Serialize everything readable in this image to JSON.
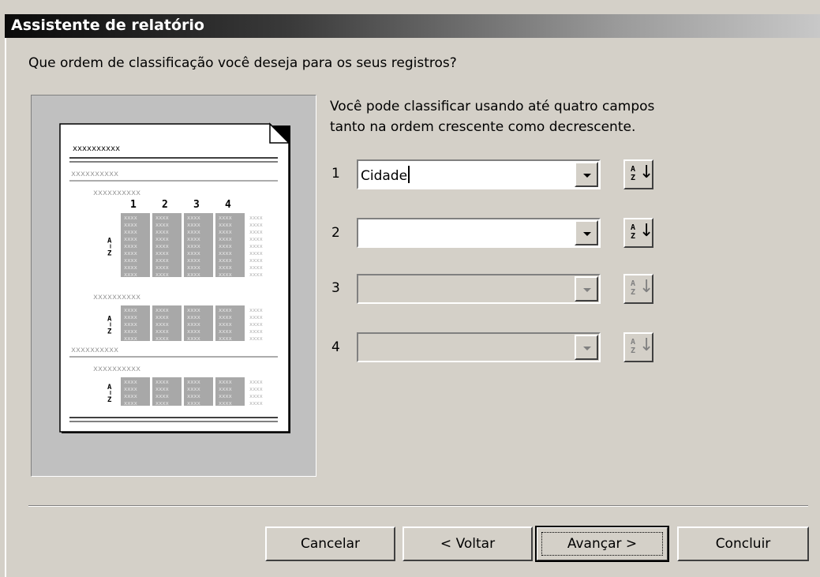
{
  "window": {
    "title": "Assistente de relatório"
  },
  "prompt": {
    "question": "Que ordem de classificação você deseja para os seus registros?"
  },
  "intro": {
    "line1": "Você pode classificar usando até quatro campos",
    "line2": "tanto na ordem crescente como decrescente."
  },
  "sort_fields": [
    {
      "number": "1",
      "value": "Cidade",
      "enabled": true
    },
    {
      "number": "2",
      "value": "",
      "enabled": true
    },
    {
      "number": "3",
      "value": "",
      "enabled": false
    },
    {
      "number": "4",
      "value": "",
      "enabled": false
    }
  ],
  "sort_button": {
    "top": "A",
    "bottom": "Z",
    "arrow": "↓",
    "icon": "sort-ascending-icon"
  },
  "preview": {
    "placeholder": "xxxxxxxxxx",
    "columns": [
      "1",
      "2",
      "3",
      "4"
    ],
    "az_top": "A",
    "az_bottom": "Z"
  },
  "buttons": {
    "cancel": "Cancelar",
    "back": "< Voltar",
    "next": "Avançar >",
    "finish": "Concluir"
  }
}
